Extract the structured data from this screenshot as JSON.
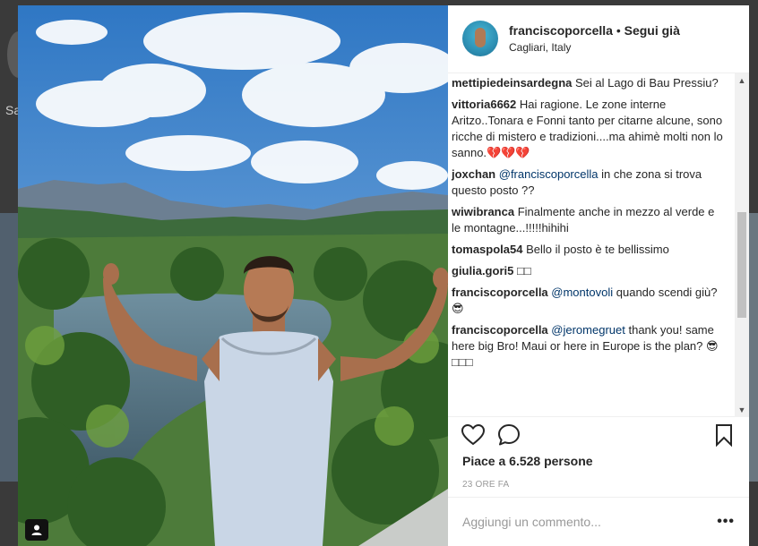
{
  "background": {
    "partial_label": "Sa"
  },
  "close": {
    "glyph": "×"
  },
  "post": {
    "username": "franciscoporcella",
    "separator": " • ",
    "follow_label": "Segui già",
    "location": "Cagliari, Italy",
    "likes_text": "Piace a 6.528 persone",
    "time_text": "23 ORE FA",
    "comment_placeholder": "Aggiungi un commento...",
    "more_label": "•••"
  },
  "comments": [
    {
      "user": "mettipiedeinsardegna",
      "mention": "",
      "text": "Sei al Lago di Bau Pressiu?"
    },
    {
      "user": "vittoria6662",
      "mention": "",
      "text": "Hai ragione. Le zone interne Aritzo..Tonara e Fonni tanto per citarne alcune, sono ricche di mistero e tradizioni....ma ahimè molti non lo sanno.💔💔💔"
    },
    {
      "user": "joxchan",
      "mention": "@franciscoporcella",
      "text": "in che zona si trova questo posto ??"
    },
    {
      "user": "wiwibranca",
      "mention": "",
      "text": "Finalmente anche in mezzo al verde e le montagne...!!!!!hihihi"
    },
    {
      "user": "tomaspola54",
      "mention": "",
      "text": "Bello il posto è te bellissimo"
    },
    {
      "user": "giulia.gori5",
      "mention": "",
      "text": "□□"
    },
    {
      "user": "franciscoporcella",
      "mention": "@montovoli",
      "text": "quando scendi giù? 😎"
    },
    {
      "user": "franciscoporcella",
      "mention": "@jeromegruet",
      "text": "thank you! same here big Bro! Maui or here in Europe is the plan? 😎□□□"
    }
  ],
  "icons": {
    "like": "heart-icon",
    "comment": "speech-bubble-icon",
    "save": "bookmark-icon",
    "tag": "person-tag-icon"
  }
}
